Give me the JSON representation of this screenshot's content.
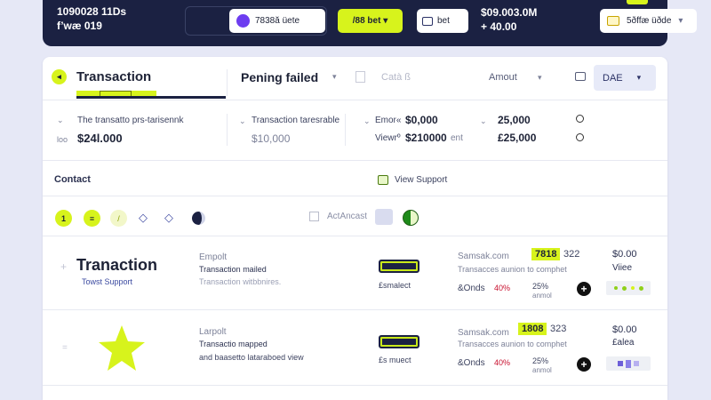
{
  "topbar": {
    "left_line1": "1090028  11Ds",
    "left_line2": "f’wæ 019",
    "account_pill": "7838ă üete",
    "bet_pill": "/88 bet ▾",
    "bet_dropdown": "bet",
    "balance_line1": "$09.003.0M",
    "balance_line2": "+ 40.00",
    "wallet_label": "5ðffæ üðde"
  },
  "tabs": {
    "transaction": "Transaction",
    "pending": "Pening failed",
    "cat": "Catà ß",
    "amount": "Amout",
    "currency": "DAE"
  },
  "summary": {
    "row1_label": "The transatto prs-tarisennk",
    "row1_value": "$24l.000",
    "row1_prefix": "loo",
    "row2_label": "Transaction taresrable",
    "row2_value": "$10,000",
    "row3_label1": "Emor«",
    "row3_value1": "$0,000",
    "row3_label2": "Viewrº",
    "row3_value2": "$210000",
    "row3_suffix": "ent",
    "row4_value1": "25,000",
    "row4_value2": "£25,000"
  },
  "contact": {
    "heading": "Contact",
    "view_support": "View Support",
    "action_text": "ActAncast",
    "toolbar_icon_1": "1"
  },
  "rows": [
    {
      "title": "Tranaction",
      "subtitle": "Towst Support",
      "meta1": "Empolt",
      "meta2": "Transaction mailed",
      "meta3": "Transaction witbbnires.",
      "status": "£smalect",
      "merchant": "Samsak.com",
      "merchant_desc": "Transacces aunion to comphet",
      "percent_label": "&Onds",
      "percent": "40%",
      "small_pct": "25%",
      "small_desc": "anmol",
      "code_chip": "7818",
      "code_tail": "322",
      "price": "$0.00",
      "price_label": "Viiee"
    },
    {
      "title": "",
      "subtitle": "",
      "meta1": "Larpolt",
      "meta2": "Transactio mapped",
      "meta3": "and baasetto lataraboed view",
      "status": "£s muect",
      "merchant": "Samsak.com",
      "merchant_desc": "Transacces aunion to comphet",
      "percent_label": "&Onds",
      "percent": "40%",
      "small_pct": "25%",
      "small_desc": "anmol",
      "code_chip": "1808",
      "code_tail": "323",
      "price": "$0.00",
      "price_label": "£alea"
    }
  ],
  "colors": {
    "accent": "#d7f31c",
    "navy": "#1b2142",
    "purple": "#6d3df0",
    "background": "#e6e8f6"
  }
}
